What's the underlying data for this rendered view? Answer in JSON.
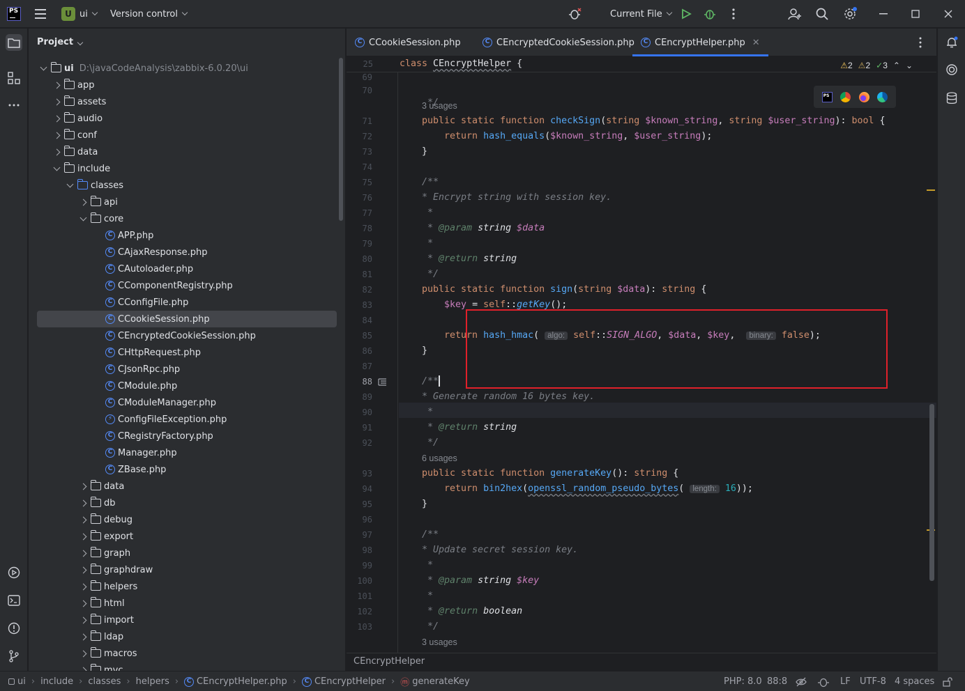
{
  "topbar": {
    "logo_text": "PS",
    "project_badge": "U",
    "project_name": "ui",
    "vcs": "Version control",
    "run_config": "Current File"
  },
  "project_panel": {
    "title": "Project",
    "root": {
      "name": "ui",
      "path": "D:\\javaCodeAnalysis\\zabbix-6.0.20\\ui"
    },
    "items": [
      {
        "label": "app"
      },
      {
        "label": "assets"
      },
      {
        "label": "audio"
      },
      {
        "label": "conf"
      },
      {
        "label": "data"
      },
      {
        "label": "include"
      },
      {
        "label": "classes"
      },
      {
        "label": "api"
      },
      {
        "label": "core"
      },
      {
        "label": "APP.php"
      },
      {
        "label": "CAjaxResponse.php"
      },
      {
        "label": "CAutoloader.php"
      },
      {
        "label": "CComponentRegistry.php"
      },
      {
        "label": "CConfigFile.php"
      },
      {
        "label": "CCookieSession.php"
      },
      {
        "label": "CEncryptedCookieSession.php"
      },
      {
        "label": "CHttpRequest.php"
      },
      {
        "label": "CJsonRpc.php"
      },
      {
        "label": "CModule.php"
      },
      {
        "label": "CModuleManager.php"
      },
      {
        "label": "ConfigFileException.php"
      },
      {
        "label": "CRegistryFactory.php"
      },
      {
        "label": "Manager.php"
      },
      {
        "label": "ZBase.php"
      },
      {
        "label": "data"
      },
      {
        "label": "db"
      },
      {
        "label": "debug"
      },
      {
        "label": "export"
      },
      {
        "label": "graph"
      },
      {
        "label": "graphdraw"
      },
      {
        "label": "helpers"
      },
      {
        "label": "html"
      },
      {
        "label": "import"
      },
      {
        "label": "ldap"
      },
      {
        "label": "macros"
      },
      {
        "label": "mvc"
      }
    ]
  },
  "tabs": [
    {
      "label": "CCookieSession.php"
    },
    {
      "label": "CEncryptedCookieSession.php"
    },
    {
      "label": "CEncryptHelper.php"
    }
  ],
  "inspections": {
    "warnings": "2",
    "weak_warnings": "2",
    "ok": "3"
  },
  "sticky": {
    "line": "25",
    "text_kw": "class",
    "text_name": "CEncryptHelper",
    "text_brace": "{"
  },
  "lines": {
    "l69": "69",
    "l70": "70",
    "l71": "71",
    "l72": "72",
    "l73": "73",
    "l74": "74",
    "l75": "75",
    "l76": "76",
    "l77": "77",
    "l78": "78",
    "l79": "79",
    "l80": "80",
    "l81": "81",
    "l82": "82",
    "l83": "83",
    "l84": "84",
    "l85": "85",
    "l86": "86",
    "l87": "87",
    "l88": "88",
    "l89": "89",
    "l90": "90",
    "l91": "91",
    "l92": "92",
    "l93": "93",
    "l94": "94",
    "l95": "95",
    "l96": "96",
    "l97": "97",
    "l98": "98",
    "l99": "99",
    "l100": "100",
    "l101": "101",
    "l102": "102",
    "l103": "103"
  },
  "code": {
    "usages_a": "3 usages",
    "usages_b": "6 usages",
    "usages_c": "3 usages",
    "comment_encrypt": "* Encrypt string with session key.",
    "comment_generate": "* Generate random 16 bytes key.",
    "comment_update": "* Update secret session key.",
    "hint_algo": "algo:",
    "hint_binary": "binary:",
    "hint_length": "length:"
  },
  "editor_breadcrumb": "CEncryptHelper",
  "statusbar": {
    "crumbs": [
      "ui",
      "include",
      "classes",
      "helpers",
      "CEncryptHelper.php",
      "CEncryptHelper",
      "generateKey"
    ],
    "php": "PHP: 8.0",
    "position": "88:8",
    "line_sep": "LF",
    "encoding": "UTF-8",
    "indent": "4 spaces"
  },
  "colors": {
    "accent": "#3574f0",
    "highlight_box": "#e0202a",
    "bg": "#1e1f22",
    "panel": "#2b2d30"
  }
}
